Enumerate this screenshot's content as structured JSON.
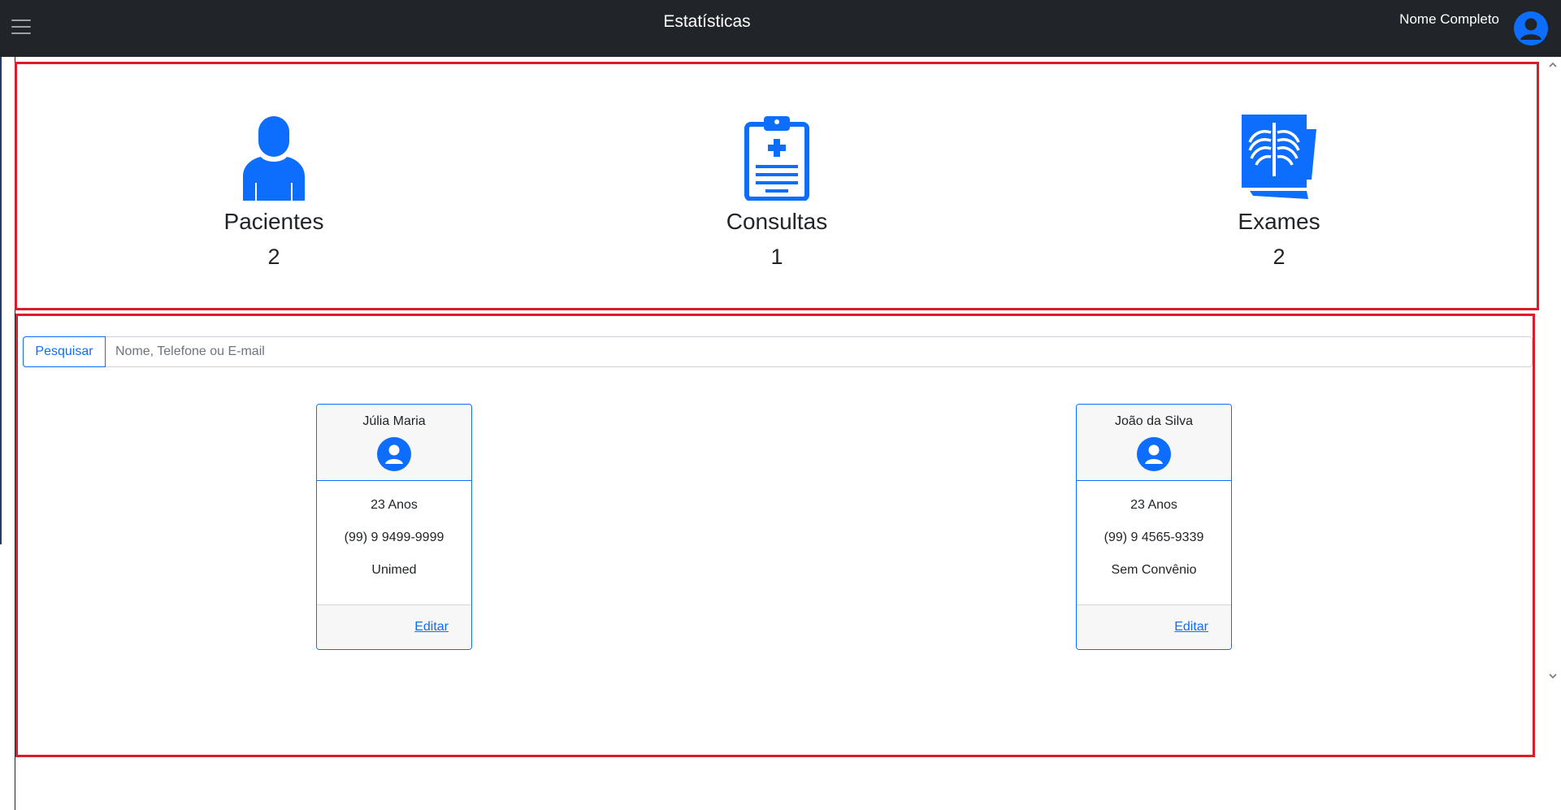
{
  "header": {
    "title": "Estatísticas",
    "user_name": "Nome Completo",
    "menu_icon": "hamburger-menu-icon",
    "avatar_icon": "user-avatar-icon"
  },
  "stats": [
    {
      "label": "Pacientes",
      "value": "2",
      "icon": "patient-icon"
    },
    {
      "label": "Consultas",
      "value": "1",
      "icon": "clipboard-medical-icon"
    },
    {
      "label": "Exames",
      "value": "2",
      "icon": "xray-icon"
    }
  ],
  "search": {
    "button_label": "Pesquisar",
    "placeholder": "Nome, Telefone ou E-mail",
    "value": ""
  },
  "patients": [
    {
      "name": "Júlia Maria",
      "age": "23 Anos",
      "phone": "(99) 9 9499-9999",
      "insurance": "Unimed",
      "edit_label": "Editar"
    },
    {
      "name": "João da Silva",
      "age": "23 Anos",
      "phone": "(99) 9 4565-9339",
      "insurance": "Sem Convênio",
      "edit_label": "Editar"
    }
  ],
  "colors": {
    "accent": "#0d6efd",
    "topbar": "#212529",
    "highlight_border": "#dc1c2a"
  }
}
